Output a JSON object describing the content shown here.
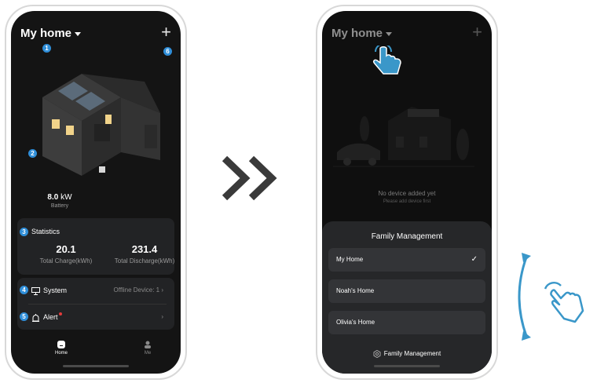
{
  "phone1": {
    "home_title": "My home",
    "badges": [
      "1",
      "2",
      "3",
      "4",
      "5",
      "6"
    ],
    "battery": {
      "value": "8.0",
      "unit": "kW",
      "label": "Battery"
    },
    "statistics": {
      "title": "Statistics",
      "charge_value": "20.1",
      "charge_label": "Total Charge(kWh)",
      "discharge_value": "231.4",
      "discharge_label": "Total Discharge(kWh)"
    },
    "system": {
      "label": "System",
      "status": "Offline Device:  1"
    },
    "alert": {
      "label": "Alert"
    },
    "tabs": {
      "home": "Home",
      "me": "Me"
    }
  },
  "phone2": {
    "home_title": "My home",
    "empty_title": "No device added yet",
    "empty_sub": "Please add device first",
    "sheet_title": "Family Management",
    "families": [
      "My Home",
      "Noah's Home",
      "Olivia's Home"
    ],
    "selected_index": 0,
    "manage_label": "Family Management"
  },
  "colors": {
    "badge": "#2f8ed8",
    "alert_dot": "#e23b3b",
    "gesture": "#3a97c9"
  },
  "icons": [
    "chevron-right-icon",
    "plus-icon",
    "monitor-icon",
    "siren-icon",
    "home-tab-icon",
    "person-tab-icon",
    "check-icon",
    "gear-icon",
    "tap-hand-icon",
    "double-arrow-icon",
    "swipe-hand-icon"
  ]
}
